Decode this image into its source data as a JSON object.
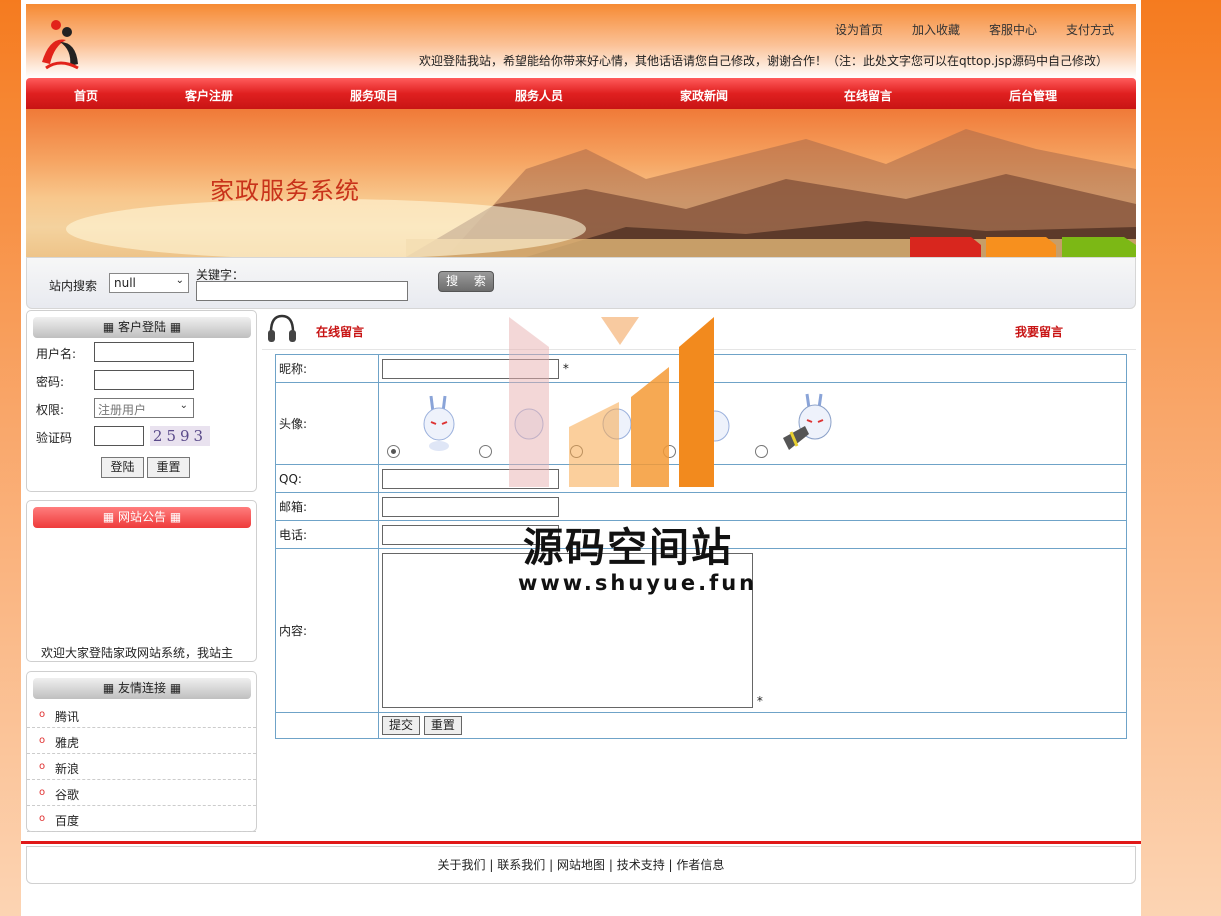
{
  "header": {
    "toplinks": [
      "设为首页",
      "加入收藏",
      "客服中心",
      "支付方式"
    ],
    "welcome": "欢迎登陆我站，希望能给你带来好心情，其他话语请您自己修改，谢谢合作！（注：此处文字您可以在qttop.jsp源码中自己修改）"
  },
  "nav": [
    "首页",
    "客户注册",
    "服务项目",
    "服务人员",
    "家政新闻",
    "在线留言",
    "后台管理"
  ],
  "banner": {
    "title": "家政服务系统"
  },
  "search": {
    "label": "站内搜索",
    "select_value": "null",
    "keyword_label": "关键字：",
    "button": "搜 索"
  },
  "login": {
    "title": "客户登陆",
    "username_label": "用户名:",
    "password_label": "密码:",
    "role_label": "权限:",
    "role_value": "注册用户",
    "captcha_label": "验证码",
    "captcha_value": "2593",
    "login_button": "登陆",
    "reset_button": "重置"
  },
  "notice": {
    "title": "网站公告",
    "text": "欢迎大家登陆家政网站系统，我站主"
  },
  "links": {
    "title": "友情连接",
    "items": [
      "腾讯",
      "雅虎",
      "新浪",
      "谷歌",
      "百度"
    ]
  },
  "main": {
    "title": "在线留言",
    "right_link": "我要留言",
    "form": {
      "nickname_label": "昵称:",
      "avatar_label": "头像:",
      "qq_label": "QQ:",
      "email_label": "邮箱:",
      "phone_label": "电话:",
      "content_label": "内容:",
      "required_mark": "*",
      "submit": "提交",
      "reset": "重置"
    }
  },
  "footer": {
    "links": [
      "关于我们",
      "联系我们",
      "网站地图",
      "技术支持",
      "作者信息"
    ],
    "separator": "|"
  },
  "watermark": {
    "text": "源码空间站",
    "url": "www.shuyue.fun"
  },
  "colors": {
    "accent": "#e02020",
    "page_bg": "#f57b1f",
    "table_border": "#6fa3c8"
  }
}
